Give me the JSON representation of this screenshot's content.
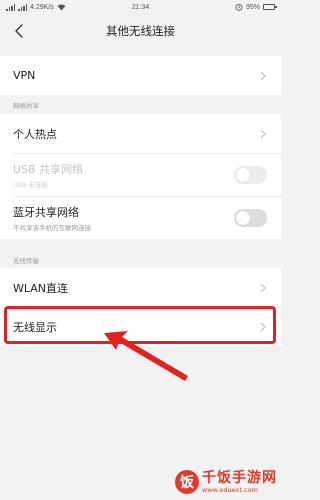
{
  "status_bar": {
    "speed": "4.29K/s",
    "time": "21:34",
    "battery": "95%",
    "battery_level": 0.95
  },
  "header": {
    "title": "其他无线连接"
  },
  "group_vpn": {
    "items": [
      {
        "label": "VPN"
      }
    ]
  },
  "section_network_sharing": {
    "label": "网络共享"
  },
  "group_sharing": {
    "items": [
      {
        "label": "个人热点"
      },
      {
        "label": "USB 共享网络",
        "sublabel": "USB 未连接",
        "toggle": false,
        "disabled": true
      },
      {
        "label": "蓝牙共享网络",
        "sublabel": "不共享该手机的互联网连接",
        "toggle": false
      }
    ]
  },
  "section_wireless_transfer": {
    "label": "无线传输"
  },
  "group_wireless": {
    "items": [
      {
        "label": "WLAN直连"
      },
      {
        "label": "无线显示"
      }
    ]
  },
  "annotation": {
    "color": "#e02222"
  },
  "watermark": {
    "logo_char": "饭",
    "name": "千饭手游网",
    "url": "www.eduext.com"
  }
}
